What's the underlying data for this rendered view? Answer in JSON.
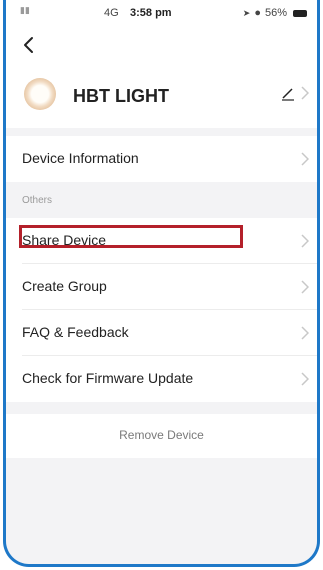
{
  "status_bar": {
    "signal": "▮▮",
    "network": "4G",
    "time": "3:58 pm",
    "battery": "56%"
  },
  "nav": {
    "back_icon": "back-chevron-icon"
  },
  "device": {
    "name": "HBT LIGHT",
    "icon": "bulb-icon",
    "edit_icon": "pencil-icon"
  },
  "menu": {
    "device_information": "Device Information",
    "section_title": "Others",
    "items": [
      {
        "label": "Share Device"
      },
      {
        "label": "Create Group"
      },
      {
        "label": "FAQ & Feedback"
      },
      {
        "label": "Check for Firmware Update"
      }
    ],
    "remove_device": "Remove Device"
  },
  "colors": {
    "frame_border": "#1e78c8",
    "highlight_border": "#b4202a",
    "background": "#f3f3f5",
    "chevron": "#c8c8c8"
  }
}
